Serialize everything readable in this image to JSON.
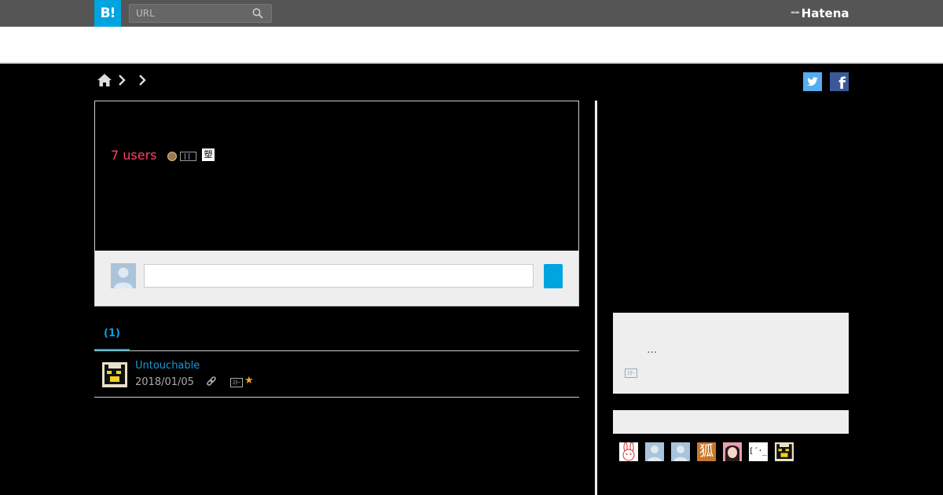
{
  "header": {
    "logo_text": "B!",
    "search_placeholder": "URL",
    "search_icon": "search-icon",
    "brand": "Hatena",
    "brand_mark": "⁼⁼"
  },
  "breadcrumb": {
    "icons": [
      "home-icon",
      "chevron-right-icon",
      "chevron-right-icon"
    ]
  },
  "share": {
    "twitter_icon": "twitter-icon",
    "facebook_label": "f"
  },
  "entry": {
    "users_count": "7 users",
    "site_icons": [
      "globe-favicon",
      "film-favicon",
      "kanji-favicon"
    ],
    "kanji_favicon_text": "塑"
  },
  "comment_form": {
    "input_value": "",
    "submit_icon": "submit-button"
  },
  "tabs": [
    {
      "label": "(1)",
      "active": true
    }
  ],
  "bookmarks": [
    {
      "user": "Untouchable",
      "date": "2018/01/05",
      "link_icon": "link-icon",
      "star_add_label": "ｽﾀｰ",
      "star": "★"
    }
  ],
  "sidebar": {
    "box1_ellipsis": "…",
    "box1_icon_label": "ｽﾀｰ",
    "user_icons": [
      "rabbit-avatar",
      "default-avatar",
      "default-avatar",
      "fox-kanji-avatar",
      "girl-avatar",
      "kaomoji-avatar",
      "pixel-cat-avatar"
    ],
    "fox_kanji": "狐",
    "kaomoji": "[´･_"
  },
  "colors": {
    "accent": "#00a4de",
    "users_count": "#ff4166",
    "topbar": "#555555",
    "link": "#1e9bd7",
    "star": "#f5a623"
  }
}
